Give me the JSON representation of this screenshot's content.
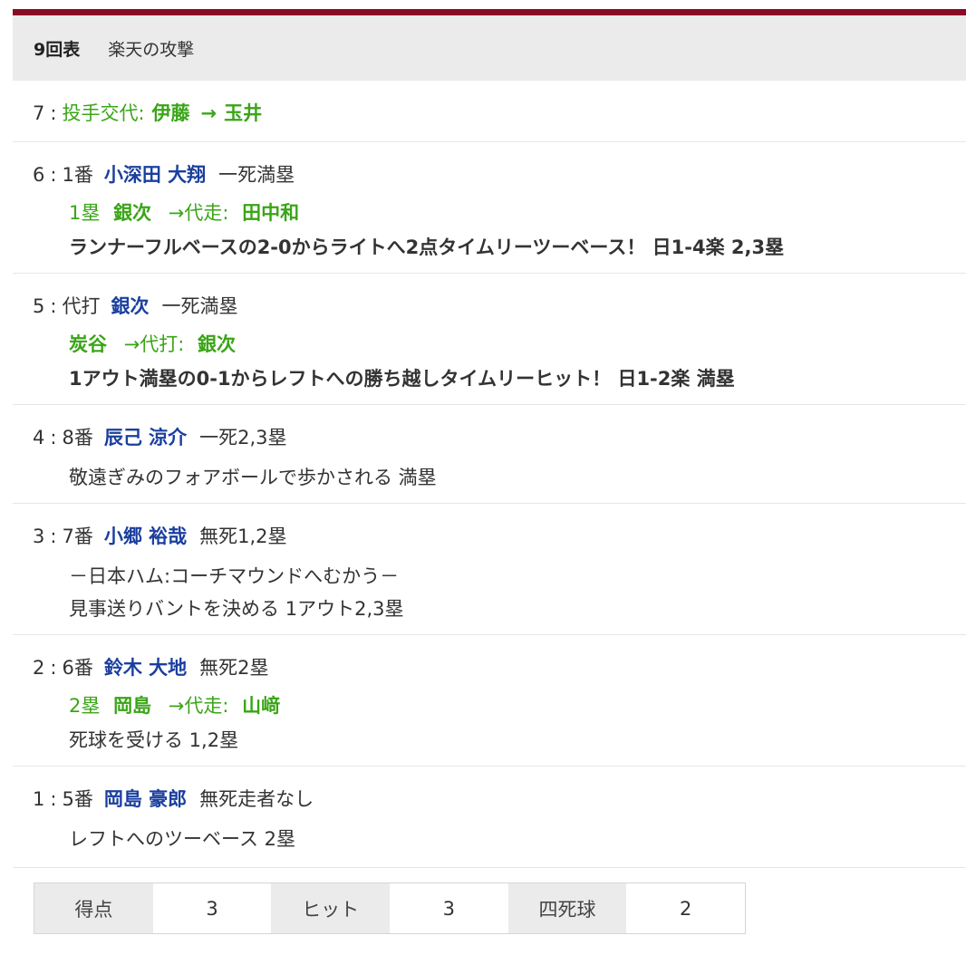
{
  "header": {
    "inning": "9回表",
    "team_attack": "楽天の攻撃"
  },
  "events": [
    {
      "num": "7",
      "colon": ":",
      "prefix": "投手交代:",
      "from": "伊藤",
      "arrow": "→",
      "to": "玉井"
    },
    {
      "num": "6",
      "colon": ":",
      "order": "1番",
      "player": "小深田 大翔",
      "situation": "一死満塁",
      "sub_base": "1塁",
      "sub_from": "銀次",
      "sub_arrow_label": "→代走:",
      "sub_to": "田中和",
      "result": "ランナーフルベースの2-0からライトへ2点タイムリーツーベース！ 日1-4楽 2,3塁"
    },
    {
      "num": "5",
      "colon": ":",
      "order": "代打",
      "player": "銀次",
      "situation": "一死満塁",
      "sub_from": "炭谷",
      "sub_arrow_label": "→代打:",
      "sub_to": "銀次",
      "result": "1アウト満塁の0-1からレフトへの勝ち越しタイムリーヒット！ 日1-2楽 満塁"
    },
    {
      "num": "4",
      "colon": ":",
      "order": "8番",
      "player": "辰己 涼介",
      "situation": "一死2,3塁",
      "result": "敬遠ぎみのフォアボールで歩かされる 満塁"
    },
    {
      "num": "3",
      "colon": ":",
      "order": "7番",
      "player": "小郷 裕哉",
      "situation": "無死1,2塁",
      "note": "－日本ハム:コーチマウンドへむかう－",
      "result": "見事送りバントを決める 1アウト2,3塁"
    },
    {
      "num": "2",
      "colon": ":",
      "order": "6番",
      "player": "鈴木 大地",
      "situation": "無死2塁",
      "sub_base": "2塁",
      "sub_from": "岡島",
      "sub_arrow_label": "→代走:",
      "sub_to": "山﨑",
      "result": "死球を受ける 1,2塁"
    },
    {
      "num": "1",
      "colon": ":",
      "order": "5番",
      "player": "岡島 豪郎",
      "situation": "無死走者なし",
      "result": "レフトへのツーベース 2塁"
    }
  ],
  "stats": [
    {
      "label": "得点",
      "value": "3"
    },
    {
      "label": "ヒット",
      "value": "3"
    },
    {
      "label": "四死球",
      "value": "2"
    }
  ],
  "colors": {
    "accent": "#8b0a25",
    "player": "#1a3f9e",
    "substitution": "#3aa517"
  }
}
